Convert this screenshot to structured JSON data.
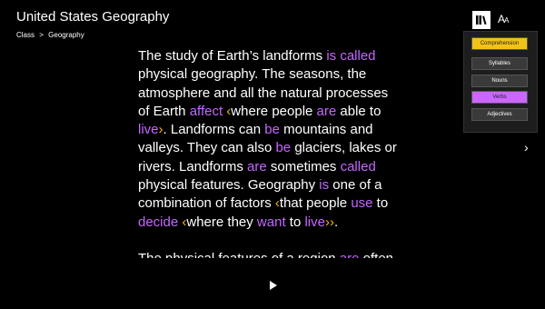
{
  "header": {
    "title": "United States Geography",
    "breadcrumb": [
      "Class",
      "Geography"
    ],
    "breadcrumb_sep": ">"
  },
  "toolbar": {
    "icons": [
      "book-icon",
      "font-size-icon"
    ],
    "font_button_big": "A",
    "font_button_small": "A"
  },
  "highlight_panel": {
    "items": [
      {
        "label": "Comprehension",
        "color": "#f3c219",
        "text_color": "#222222"
      },
      {
        "label": "Syllables",
        "color": "#3a3a3a",
        "text_color": "#ffffff"
      },
      {
        "label": "Nouns",
        "color": "#3a3a3a",
        "text_color": "#ffffff"
      },
      {
        "label": "Verbs",
        "color": "#cc66ff",
        "text_color": "#222222"
      },
      {
        "label": "Adjectives",
        "color": "#3a3a3a",
        "text_color": "#ffffff"
      }
    ]
  },
  "colors": {
    "background": "#000000",
    "verb": "#c566ff",
    "clause": "#f3b413"
  },
  "reader": {
    "lines": [
      [
        {
          "t": "The study of Earth’s landforms "
        },
        {
          "t": "is called",
          "c": "verb"
        }
      ],
      [
        {
          "t": "physical geography. The seasons, the"
        }
      ],
      [
        {
          "t": "atmosphere and all the natural processes"
        }
      ],
      [
        {
          "t": "of Earth "
        },
        {
          "t": "affect",
          "c": "verb"
        },
        {
          "t": " "
        },
        {
          "t": "‹",
          "c": "clause"
        },
        {
          "t": "where people "
        },
        {
          "t": "are",
          "c": "verb"
        },
        {
          "t": " able to"
        }
      ],
      [
        {
          "t": "live",
          "c": "verb"
        },
        {
          "t": "›",
          "c": "clause"
        },
        {
          "t": ". Landforms can "
        },
        {
          "t": "be",
          "c": "verb"
        },
        {
          "t": " mountains and"
        }
      ],
      [
        {
          "t": "valleys. They can also "
        },
        {
          "t": "be",
          "c": "verb"
        },
        {
          "t": " glaciers, lakes or"
        }
      ],
      [
        {
          "t": "rivers. Landforms "
        },
        {
          "t": "are",
          "c": "verb"
        },
        {
          "t": " sometimes "
        },
        {
          "t": "called",
          "c": "verb"
        }
      ],
      [
        {
          "t": "physical features. Geography "
        },
        {
          "t": "is",
          "c": "verb"
        },
        {
          "t": " one of a"
        }
      ],
      [
        {
          "t": "combination of factors "
        },
        {
          "t": "‹",
          "c": "clause"
        },
        {
          "t": "that people "
        },
        {
          "t": "use",
          "c": "verb"
        },
        {
          "t": " to"
        }
      ],
      [
        {
          "t": "decide",
          "c": "verb"
        },
        {
          "t": " "
        },
        {
          "t": "‹",
          "c": "clause"
        },
        {
          "t": "where they "
        },
        {
          "t": "want",
          "c": "verb"
        },
        {
          "t": " to "
        },
        {
          "t": "live",
          "c": "verb"
        },
        {
          "t": "››",
          "c": "clause"
        },
        {
          "t": "."
        }
      ],
      [
        {
          "t": ""
        }
      ],
      [
        {
          "t": "The physical features of a region "
        },
        {
          "t": "are",
          "c": "verb"
        },
        {
          "t": " often"
        }
      ]
    ]
  },
  "nav": {
    "next_icon": "chevron-right-icon",
    "play_icon": "play-icon"
  }
}
